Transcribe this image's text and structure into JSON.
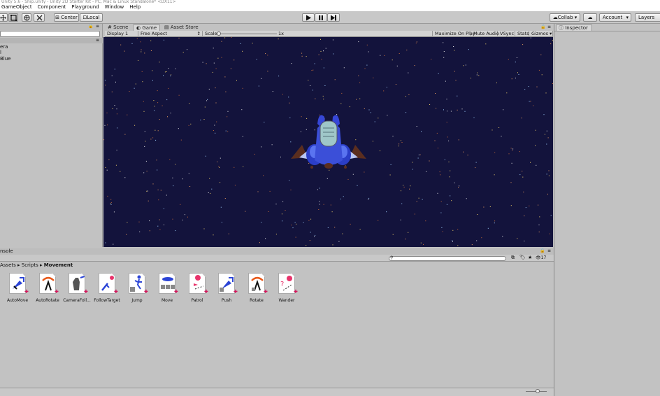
{
  "window": {
    "title": "Unity 5.6 - Ship.unity - Unity 2D Starter Kit - PC, Mac & Linux Standalone* <DX11>"
  },
  "menu": [
    "GameObject",
    "Component",
    "Playground",
    "Window",
    "Help"
  ],
  "toolbar": {
    "center_label": "Center",
    "local_label": "Local",
    "collab_label": "Collab",
    "account_label": "Account",
    "layers_label": "Layers"
  },
  "hierarchy": {
    "items": [
      "era",
      "l",
      "Blue"
    ]
  },
  "tabs": {
    "scene": "Scene",
    "game": "Game",
    "asset_store": "Asset Store",
    "inspector": "Inspector"
  },
  "gamebar": {
    "display": "Display 1",
    "aspect": "Free Aspect",
    "scale_label": "Scale",
    "scale_value": "1x",
    "maximize": "Maximize On Play",
    "mute": "Mute Audio",
    "vsync": "VSync",
    "stats": "Stats",
    "gizmos": "Gizmos"
  },
  "bottom": {
    "panel_title": "nsole",
    "count": "17",
    "breadcrumb": [
      "Assets",
      "Scripts",
      "Movement"
    ]
  },
  "assets": [
    {
      "label": "AutoMove",
      "icon": "automove-icon"
    },
    {
      "label": "AutoRotate",
      "icon": "autorotate-icon"
    },
    {
      "label": "CameraFoll...",
      "icon": "camerafollow-icon"
    },
    {
      "label": "FollowTarget",
      "icon": "followtarget-icon"
    },
    {
      "label": "Jump",
      "icon": "jump-icon"
    },
    {
      "label": "Move",
      "icon": "move-icon"
    },
    {
      "label": "Patrol",
      "icon": "patrol-icon"
    },
    {
      "label": "Push",
      "icon": "push-icon"
    },
    {
      "label": "Rotate",
      "icon": "rotate-icon"
    },
    {
      "label": "Wander",
      "icon": "wander-icon"
    }
  ],
  "colors": {
    "game_bg": "#13133c",
    "panel": "#c2c2c2",
    "ship": "#3b4fd8",
    "badge": "#d4145a"
  }
}
